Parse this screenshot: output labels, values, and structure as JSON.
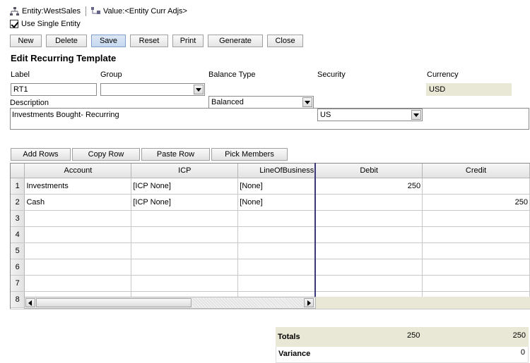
{
  "header": {
    "entity_label": "Entity:WestSales",
    "value_label": "Value:<Entity Curr Adjs>"
  },
  "options": {
    "use_single_entity_label": "Use Single Entity",
    "use_single_entity_checked": true
  },
  "toolbar": {
    "new_label": "New",
    "delete_label": "Delete",
    "save_label": "Save",
    "reset_label": "Reset",
    "print_label": "Print",
    "generate_label": "Generate",
    "close_label": "Close"
  },
  "form": {
    "title": "Edit Recurring Template",
    "label_caption": "Label",
    "label_value": "RT1",
    "group_caption": "Group",
    "group_value": "",
    "balance_type_caption": "Balance Type",
    "balance_type_value": "Balanced",
    "security_caption": "Security",
    "security_value": "US",
    "currency_caption": "Currency",
    "currency_value": "USD",
    "description_caption": "Description",
    "description_value": "Investments Bought- Recurring"
  },
  "grid_toolbar": {
    "add_rows_label": "Add Rows",
    "copy_row_label": "Copy Row",
    "paste_row_label": "Paste Row",
    "pick_members_label": "Pick Members"
  },
  "grid": {
    "columns": [
      "Account",
      "ICP",
      "LineOfBusiness",
      "Debit",
      "Credit"
    ],
    "rows": [
      {
        "n": "1",
        "account": "Investments",
        "icp": "[ICP None]",
        "lob": "[None]",
        "debit": "250",
        "credit": ""
      },
      {
        "n": "2",
        "account": "Cash",
        "icp": "[ICP None]",
        "lob": "[None]",
        "debit": "",
        "credit": "250"
      },
      {
        "n": "3",
        "account": "",
        "icp": "",
        "lob": "",
        "debit": "",
        "credit": ""
      },
      {
        "n": "4",
        "account": "",
        "icp": "",
        "lob": "",
        "debit": "",
        "credit": ""
      },
      {
        "n": "5",
        "account": "",
        "icp": "",
        "lob": "",
        "debit": "",
        "credit": ""
      },
      {
        "n": "6",
        "account": "",
        "icp": "",
        "lob": "",
        "debit": "",
        "credit": ""
      },
      {
        "n": "7",
        "account": "",
        "icp": "",
        "lob": "",
        "debit": "",
        "credit": ""
      },
      {
        "n": "8",
        "account": "",
        "icp": "",
        "lob": "",
        "debit": "",
        "credit": ""
      }
    ]
  },
  "totals": {
    "totals_label": "Totals",
    "debit_total": "250",
    "credit_total": "250",
    "variance_label": "Variance",
    "variance_value": "0"
  },
  "colors": {
    "readonly_bg": "#e9e7d6",
    "frozen_divider": "#3a3a7a"
  }
}
